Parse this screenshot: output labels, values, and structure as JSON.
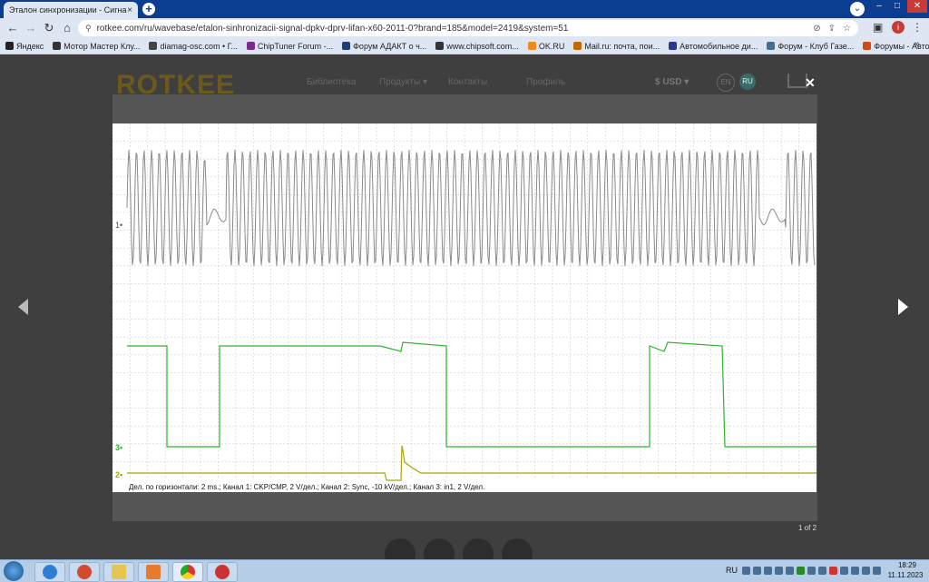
{
  "browser": {
    "tab_title": "Эталон синхронизации - Сигна",
    "url": "rotkee.com/ru/wavebase/etalon-sinhronizacii-signal-dpkv-dprv-lifan-x60-2011-0?brand=185&model=2419&system=51",
    "bookmarks": [
      "Яндекс",
      "Мотор Мастер Клу...",
      "diamag-osc.com • Г...",
      "ChipTuner Forum -...",
      "Форум АДАКТ о ч...",
      "www.chipsoft.com...",
      "OK.RU",
      "Mail.ru: почта, пои...",
      "Автомобильное ди...",
      "Форум - Клуб Газе...",
      "Форумы - Автомоб..."
    ],
    "bookmark_colors": [
      "#222222",
      "#333333",
      "#444444",
      "#7a2a8c",
      "#1f3b7a",
      "#333333",
      "#f28a1a",
      "#c06a00",
      "#2a3a8c",
      "#4a6d94",
      "#d04a1a"
    ]
  },
  "site": {
    "logo": "ROTKEE",
    "nav": [
      "Библиотека",
      "Продукты ▾",
      "Контакты",
      "Профиль"
    ],
    "currency": "$ USD ▾",
    "lang_en": "EN",
    "lang_ru": "RU",
    "close": "✕"
  },
  "oscillogram": {
    "caption": "Дел. по горизонтали: 2 ms.; Канал 1: CKP/CMP, 2 V/дел.; Канал 2: Sync, -10 kV/дел.; Канал 3: in1, 2 V/дел.",
    "channel_markers": [
      "1",
      "3",
      "2"
    ],
    "colors": {
      "ch1": "#8a8a8a",
      "ch3": "#2db52d",
      "ch2": "#a6a600",
      "grid": "#cfcfcf"
    }
  },
  "pager": "1 of 2",
  "taskbar": {
    "lang": "RU",
    "time": "18:29",
    "date": "11.11.2023"
  }
}
